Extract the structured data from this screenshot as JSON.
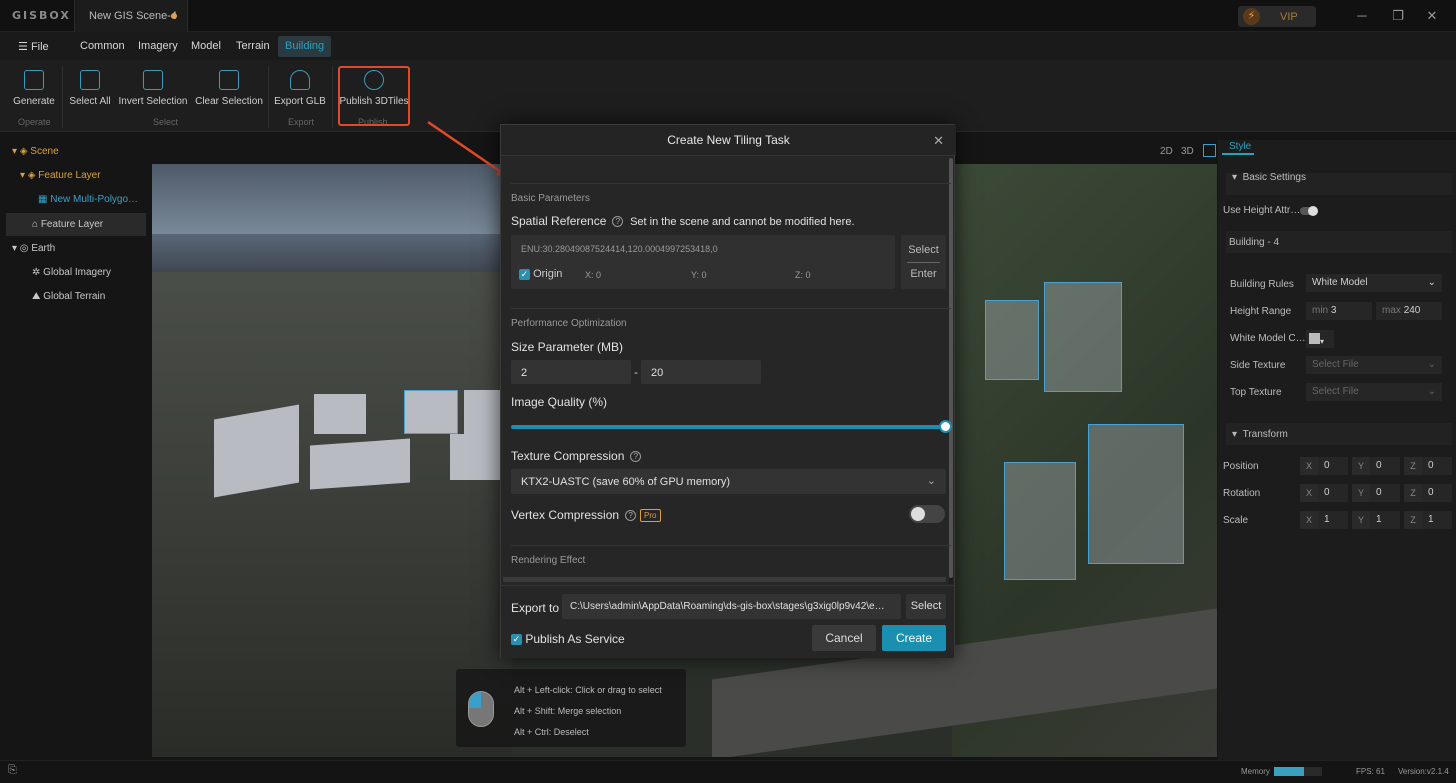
{
  "app": {
    "logo": "GISBOX",
    "doc_tab": "New GIS Scene-4",
    "vip": "VIP"
  },
  "menu": {
    "file": "File",
    "items": [
      "Common",
      "Imagery",
      "Model",
      "Terrain",
      "Building"
    ],
    "active": "Building"
  },
  "ribbon": {
    "buttons": [
      "Generate",
      "Select All",
      "Invert Selection",
      "Clear Selection",
      "Export GLB",
      "Publish 3DTiles"
    ],
    "groups": [
      "Operate",
      "Select",
      "Export",
      "Publish"
    ]
  },
  "tree": {
    "scene": "Scene",
    "feature_layer": "Feature Layer",
    "multi_polygon": "New Multi-Polygo…",
    "feature_layer2": "Feature Layer",
    "earth": "Earth",
    "global_imagery": "Global Imagery",
    "global_terrain": "Global Terrain"
  },
  "viewport": {
    "view_modes": [
      "2D",
      "3D"
    ],
    "hints": [
      "Alt + Left-click: Click or drag to select",
      "Alt + Shift: Merge selection",
      "Alt + Ctrl: Deselect"
    ]
  },
  "right_panel": {
    "tab": "Style",
    "basic_settings": "Basic Settings",
    "use_height_attr": "Use Height Attr…",
    "building_name": "Building - 4",
    "building_rules_label": "Building Rules",
    "building_rules_value": "White Model",
    "height_range_label": "Height Range",
    "height_min_label": "min",
    "height_min": "3",
    "height_max_label": "max",
    "height_max": "240",
    "white_model_color_label": "White Model C…",
    "side_texture_label": "Side Texture",
    "side_texture_value": "Select File",
    "top_texture_label": "Top Texture",
    "top_texture_value": "Select File",
    "transform": "Transform",
    "position_label": "Position",
    "rotation_label": "Rotation",
    "scale_label": "Scale",
    "axes": [
      "X",
      "Y",
      "Z"
    ],
    "position": [
      "0",
      "0",
      "0"
    ],
    "rotation": [
      "0",
      "0",
      "0"
    ],
    "scale": [
      "1",
      "1",
      "1"
    ]
  },
  "dialog": {
    "title": "Create New Tiling Task",
    "basic_params": "Basic Parameters",
    "spatial_ref_label": "Spatial Reference",
    "spatial_ref_note": "Set in the scene and cannot be modified here.",
    "enu": "ENU:30.28049087524414,120.0004997253418,0",
    "origin_label": "Origin",
    "origin_x_label": "X:",
    "origin_x": "0",
    "origin_y_label": "Y:",
    "origin_y": "0",
    "origin_z_label": "Z:",
    "origin_z": "0",
    "select_label": "Select",
    "enter_label": "Enter",
    "perf_opt": "Performance Optimization",
    "size_param_label": "Size Parameter (MB)",
    "size_min": "2",
    "size_dash": "-",
    "size_max": "20",
    "image_quality_label": "Image Quality (%)",
    "image_quality_value": 100,
    "texture_compression_label": "Texture Compression",
    "texture_compression_value": "KTX2-UASTC (save 60% of GPU memory)",
    "vertex_compression_label": "Vertex Compression",
    "pro_badge": "Pro",
    "rendering_effect": "Rendering Effect",
    "export_to_label": "Export to",
    "export_path": "C:\\Users\\admin\\AppData\\Roaming\\ds-gis-box\\stages\\g3xig0lp9v42\\e…",
    "export_select": "Select",
    "publish_service_label": "Publish As Service",
    "cancel": "Cancel",
    "create": "Create"
  },
  "status": {
    "memory_label": "Memory",
    "memory_fraction": 0.62,
    "fps": "FPS: 61",
    "version": "Version:v2.1.4"
  },
  "colors": {
    "accent": "#1a8fb0",
    "highlight": "#e04a2a",
    "tree_yellow": "#d8a040"
  }
}
